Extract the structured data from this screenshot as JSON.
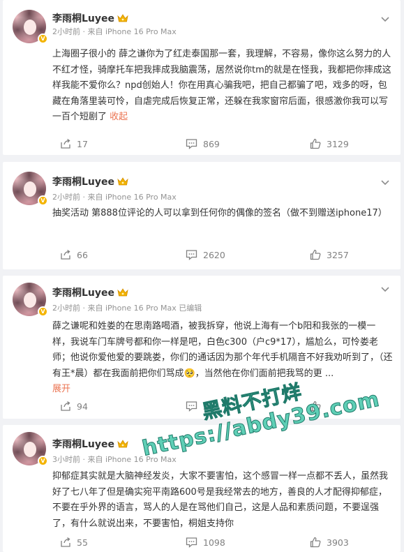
{
  "colors": {
    "page_background": "#f1f2f5",
    "card_background": "#ffffff",
    "username": "#333333",
    "meta": "#939393",
    "link": "#eb7350",
    "action_text": "#808080",
    "badge": "#f4b400",
    "watermark": "#5fcfb6"
  },
  "posts": [
    {
      "username": "李雨桐Luyee",
      "meta": "2小时前 · 来自 iPhone 16 Pro Max",
      "content": "上海圈子很小的 薛之谦你为了红走泰国那一套，我理解，不容易，像你这么努力的人不红才怪，骑摩托车把我摔成我脑震荡，居然说你tm的就是在怪我，我都把你摔成这样我能不爱你么？npd创始人！你在用真心骗我吧，把自己都骗了吧，戏多的呀，包藏在角落里装可怜，自虐完成后恢复正常，还躲在我家窗帘后面，很感激你我可以写一百个短剧了",
      "toggle_label": "收起",
      "reposts": "17",
      "comments": "869",
      "likes": "3129"
    },
    {
      "username": "李雨桐Luyee",
      "meta": "2小时前 · 来自 iPhone 16 Pro Max",
      "content": "抽奖活动 第888位评论的人可以拿到任何你的偶像的签名（做不到赠送iphone17）",
      "toggle_label": "",
      "reposts": "66",
      "comments": "2620",
      "likes": "3257"
    },
    {
      "username": "李雨桐Luyee",
      "meta": "2小时前 · 来自 iPhone 16 Pro Max 已编辑",
      "content": "薛之谦呢和姓娄的在思南路喝酒，被我拆穿，他说上海有一个b阳和我张的一模一样，我说车门车牌号都和你一样是吧，白色c300（户c9*17），尴尬么，可怜娄老师；他说你爱他爱的要跳娄，你们的通话因为那个年代手机隔音不好我劝听到了，（还有王*晨）都在我面前把你们骂成🥺，当然他在你们面前把我骂的更 ...",
      "toggle_label": "展开",
      "reposts": "94",
      "comments": "2",
      "likes": ""
    },
    {
      "username": "李雨桐Luyee",
      "meta": "3小时前 · 来自 iPhone 16 Pro Max",
      "content": "抑郁症其实就是大脑神经发炎，大家不要害怕，这个感冒一样一点都不丢人，虽然我好了七八年了但是确实宛平南路600号是我经常去的地方，善良的人才配得抑郁症，不要在乎外界的语言，骂人的人是在骂他们自己，这是人品和素质问题，不要逞强了，有什么就说出来，不要害怕，桐姐支持你",
      "toggle_label": "",
      "reposts": "55",
      "comments": "1098",
      "likes": "3903"
    }
  ],
  "icons": {
    "repost": "repost-icon",
    "comment": "comment-icon",
    "like": "thumbs-up-icon",
    "more": "chevron-down-icon",
    "verified": "verified-badge-icon",
    "member": "crown-icon"
  },
  "watermark": {
    "line1": "黑料不打烊",
    "line2": "https://abdy39.com"
  }
}
